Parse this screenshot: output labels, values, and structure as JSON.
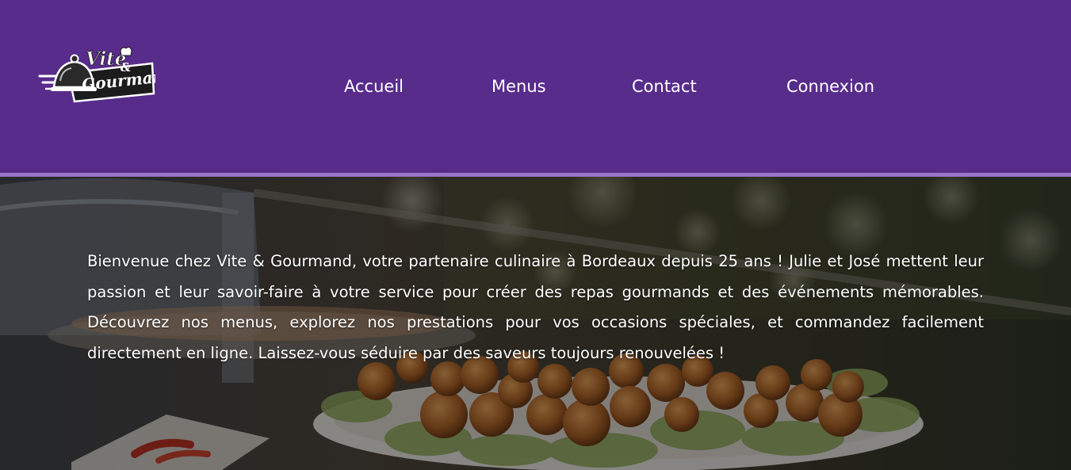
{
  "header": {
    "background_color": "#582c8b",
    "stripe_color": "#9b74c9",
    "logo": {
      "line1": "Vite",
      "ampersand": "&",
      "line2": "Gourmand",
      "icon": "cloche-icon"
    }
  },
  "nav": {
    "items": [
      {
        "label": "Accueil"
      },
      {
        "label": "Menus"
      },
      {
        "label": "Contact"
      },
      {
        "label": "Connexion"
      }
    ]
  },
  "hero": {
    "image": "catering-buffet-photo",
    "intro_text": "Bienvenue chez Vite & Gourmand, votre partenaire culinaire à Bordeaux depuis 25 ans ! Julie et José mettent leur passion et leur savoir-faire à votre service pour créer des repas gourmands et des événements mémorables. Découvrez nos menus, explorez nos prestations pour vos occasions spéciales, et commandez facilement directement en ligne. Laissez-vous séduire par des saveurs toujours renouvelées !"
  }
}
